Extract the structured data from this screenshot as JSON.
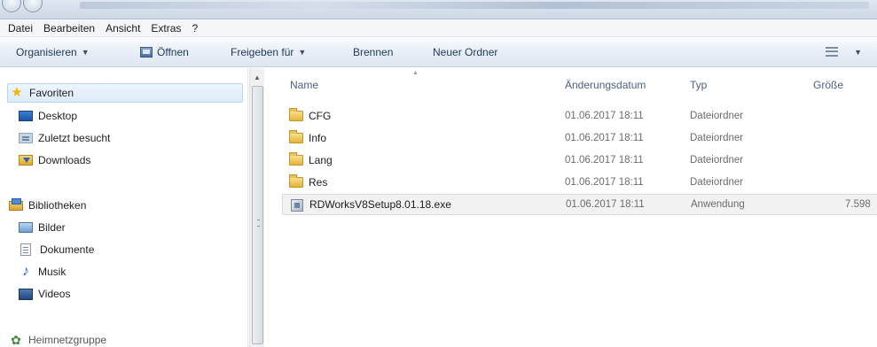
{
  "menu": [
    "Datei",
    "Bearbeiten",
    "Ansicht",
    "Extras",
    "?"
  ],
  "toolbar": {
    "organize": "Organisieren",
    "open": "Öffnen",
    "share": "Freigeben für",
    "burn": "Brennen",
    "new_folder": "Neuer Ordner"
  },
  "nav": {
    "favorites": "Favoriten",
    "favorite_items": [
      "Desktop",
      "Zuletzt besucht",
      "Downloads"
    ],
    "libraries": "Bibliotheken",
    "library_items": [
      "Bilder",
      "Dokumente",
      "Musik",
      "Videos"
    ],
    "homegroup": "Heimnetzgruppe"
  },
  "columns": {
    "name": "Name",
    "date": "Änderungsdatum",
    "type": "Typ",
    "size": "Größe"
  },
  "files": [
    {
      "name": "CFG",
      "date": "01.06.2017 18:11",
      "type": "Dateiordner",
      "size": ""
    },
    {
      "name": "Info",
      "date": "01.06.2017 18:11",
      "type": "Dateiordner",
      "size": ""
    },
    {
      "name": "Lang",
      "date": "01.06.2017 18:11",
      "type": "Dateiordner",
      "size": ""
    },
    {
      "name": "Res",
      "date": "01.06.2017 18:11",
      "type": "Dateiordner",
      "size": ""
    },
    {
      "name": "RDWorksV8Setup8.01.18.exe",
      "date": "01.06.2017 18:11",
      "type": "Anwendung",
      "size": "7.598"
    }
  ],
  "colors": {
    "toolbar_text": "#1e395b",
    "column_header": "#4d6185",
    "selection": "#dcebfb"
  },
  "icons": {
    "favorites": "star-icon",
    "desktop": "desktop-icon",
    "recent": "recent-places-icon",
    "downloads": "downloads-icon",
    "libraries": "library-icon",
    "pictures": "pictures-icon",
    "documents": "documents-icon",
    "music": "music-icon",
    "videos": "videos-icon",
    "homegroup": "homegroup-icon",
    "folder": "folder-icon",
    "exe": "application-icon"
  }
}
